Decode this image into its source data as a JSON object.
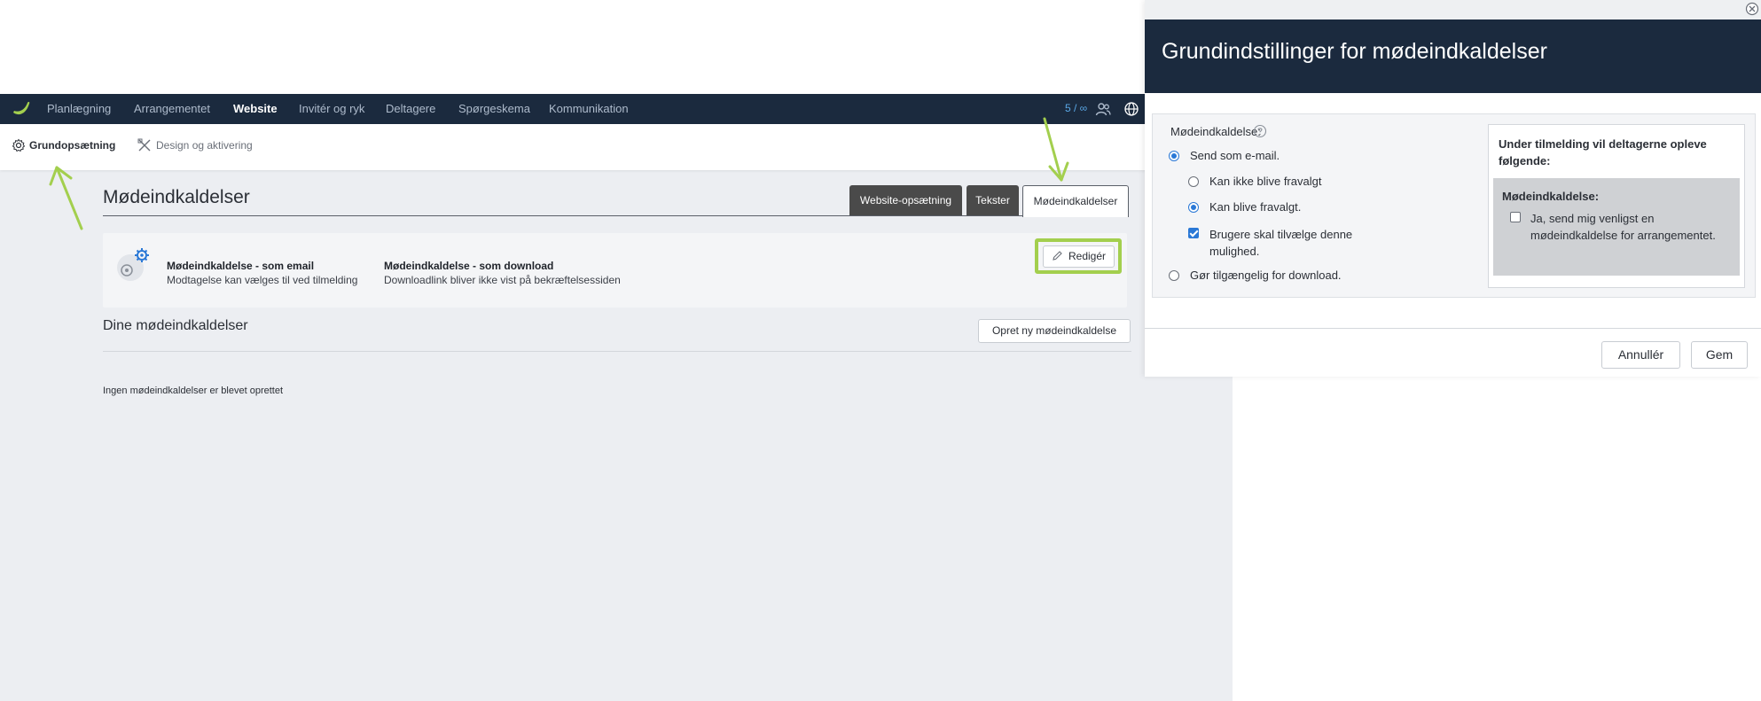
{
  "nav": {
    "items": [
      "Planlægning",
      "Arrangementet",
      "Website",
      "Invitér og ryk",
      "Deltagere",
      "Spørgeskema",
      "Kommunikation"
    ],
    "active": "Website",
    "count": "5 / ∞",
    "icons": [
      "users-icon",
      "globe-icon"
    ]
  },
  "subnav": {
    "items": [
      "Grundopsætning",
      "Design og aktivering"
    ],
    "active": "Grundopsætning"
  },
  "page": {
    "title": "Mødeindkaldelser",
    "tabs": [
      "Website-opsætning",
      "Tekster",
      "Mødeindkaldelser"
    ],
    "active_tab": "Mødeindkaldelser"
  },
  "card": {
    "email_title": "Mødeindkaldelse - som email",
    "email_desc": "Modtagelse kan vælges til ved tilmelding",
    "download_title": "Mødeindkaldelse - som download",
    "download_desc": "Downloadlink bliver ikke vist på bekræftelsessiden",
    "edit_label": "Redigér"
  },
  "list": {
    "title": "Dine mødeindkaldelser",
    "create_label": "Opret ny mødeindkaldelse",
    "empty": "Ingen mødeindkaldelser er blevet oprettet"
  },
  "modal": {
    "title": "Grundindstillinger for mødeindkaldelser",
    "field_label": "Mødeindkaldelse:",
    "options": {
      "send_email": "Send som e-mail.",
      "not_deselectable": "Kan ikke blive fravalgt",
      "deselectable": "Kan blive fravalgt.",
      "must_opt_in": "Brugere skal tilvælge denne mulighed.",
      "download": "Gør tilgængelig for download."
    },
    "preview_heading": "Under tilmelding vil deltagerne opleve følgende:",
    "preview_label": "Mødeindkaldelse:",
    "preview_checkbox": "Ja, send mig venligst en mødeindkaldelse for arrangementet.",
    "cancel_label": "Annullér",
    "save_label": "Gem"
  },
  "colors": {
    "nav_bg": "#1b2a3e",
    "highlight": "#a3cf4e",
    "accent": "#2a78d6",
    "count": "#5aa8e6"
  }
}
